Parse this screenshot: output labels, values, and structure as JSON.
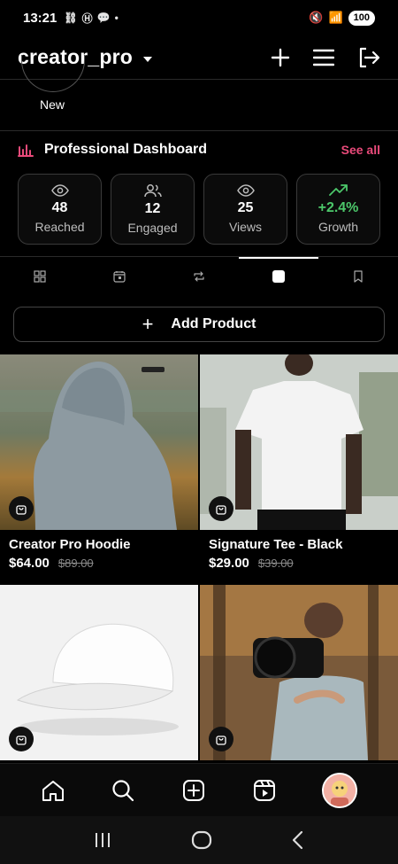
{
  "status": {
    "time": "13:21",
    "battery": "100"
  },
  "header": {
    "username": "creator_pro"
  },
  "story": {
    "label": "New"
  },
  "dashboard": {
    "title": "Professional Dashboard",
    "see_all": "See all",
    "cards": [
      {
        "value": "48",
        "label": "Reached",
        "icon": "eye-icon"
      },
      {
        "value": "12",
        "label": "Engaged",
        "icon": "users-icon"
      },
      {
        "value": "25",
        "label": "Views",
        "icon": "eye-icon"
      },
      {
        "value": "+2.4%",
        "label": "Growth",
        "icon": "trend-up-icon"
      }
    ]
  },
  "tabs": [
    "grid-icon",
    "calendar-icon",
    "repost-icon",
    "shop-icon",
    "bookmark-icon"
  ],
  "add_product": {
    "label": "Add Product"
  },
  "products": [
    {
      "name": "Creator Pro Hoodie",
      "price": "$64.00",
      "old_price": "$89.00"
    },
    {
      "name": "Signature Tee - Black",
      "price": "$29.00",
      "old_price": "$39.00"
    },
    {
      "name": "",
      "price": "",
      "old_price": ""
    },
    {
      "name": "",
      "price": "",
      "old_price": ""
    }
  ],
  "colors": {
    "accent": "#e94a7a",
    "growth": "#4cc76a",
    "background": "#000000"
  }
}
